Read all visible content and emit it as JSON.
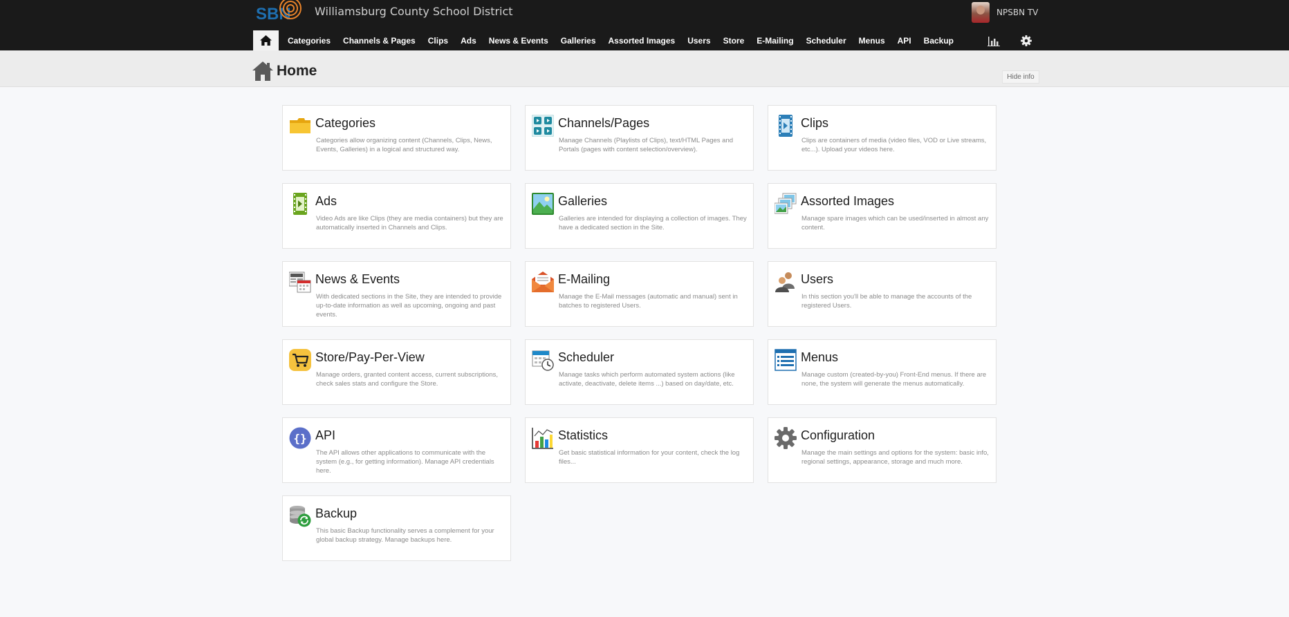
{
  "header": {
    "logo_text": "SBN",
    "site_title": "Williamsburg County School District",
    "user_name": "NPSBN TV"
  },
  "nav": {
    "items": [
      {
        "label": "Categories"
      },
      {
        "label": "Channels & Pages"
      },
      {
        "label": "Clips"
      },
      {
        "label": "Ads"
      },
      {
        "label": "News & Events"
      },
      {
        "label": "Galleries"
      },
      {
        "label": "Assorted Images"
      },
      {
        "label": "Users"
      },
      {
        "label": "Store"
      },
      {
        "label": "E-Mailing"
      },
      {
        "label": "Scheduler"
      },
      {
        "label": "Menus"
      },
      {
        "label": "API"
      },
      {
        "label": "Backup"
      }
    ],
    "icons": [
      "home-icon",
      "statistics-icon",
      "gear-icon"
    ]
  },
  "page": {
    "title": "Home",
    "hide_info_label": "Hide info"
  },
  "cards": [
    {
      "title": "Categories",
      "icon": "folder-icon",
      "desc": "Categories allow organizing content (Channels, Clips, News, Events, Galleries) in a logical and structured way."
    },
    {
      "title": "Channels/Pages",
      "icon": "channels-icon",
      "desc": "Manage Channels (Playlists of Clips), text/HTML Pages and Portals (pages with content selection/overview)."
    },
    {
      "title": "Clips",
      "icon": "film-icon",
      "desc": "Clips are containers of media (video files, VOD or Live streams, etc...). Upload your videos here."
    },
    {
      "title": "Ads",
      "icon": "ad-video-icon",
      "desc": "Video Ads are like Clips (they are media containers) but they are automatically inserted in Channels and Clips."
    },
    {
      "title": "Galleries",
      "icon": "landscape-icon",
      "desc": "Galleries are intended for displaying a collection of images. They have a dedicated section in the Site."
    },
    {
      "title": "Assorted Images",
      "icon": "images-icon",
      "desc": "Manage spare images which can be used/inserted in almost any content."
    },
    {
      "title": "News & Events",
      "icon": "news-icon",
      "desc": "With dedicated sections in the Site, they are intended to provide up-to-date information as well as upcoming, ongoing and past events."
    },
    {
      "title": "E-Mailing",
      "icon": "envelope-icon",
      "desc": "Manage the E-Mail messages (automatic and manual) sent in batches to registered Users."
    },
    {
      "title": "Users",
      "icon": "users-icon",
      "desc": "In this section you'll be able to manage the accounts of the registered Users."
    },
    {
      "title": "Store/Pay-Per-View",
      "icon": "cart-icon",
      "desc": "Manage orders, granted content access, current subscriptions, check sales stats and configure the Store."
    },
    {
      "title": "Scheduler",
      "icon": "calendar-clock-icon",
      "desc": "Manage tasks which perform automated system actions (like activate, deactivate, delete items ...) based on day/date, etc."
    },
    {
      "title": "Menus",
      "icon": "menu-list-icon",
      "desc": "Manage custom (created-by-you) Front-End menus. If there are none, the system will generate the menus automatically."
    },
    {
      "title": "API",
      "icon": "braces-icon",
      "desc": "The API allows other applications to communicate with the system (e.g., for getting information). Manage API credentials here."
    },
    {
      "title": "Statistics",
      "icon": "chart-icon",
      "desc": "Get basic statistical information for your content, check the log files..."
    },
    {
      "title": "Configuration",
      "icon": "cog-icon",
      "desc": "Manage the main settings and options for the system: basic info, regional settings, appearance, storage and much more."
    },
    {
      "title": "Backup",
      "icon": "database-backup-icon",
      "desc": "This basic Backup functionality serves a complement for your global backup strategy. Manage backups here."
    }
  ],
  "colors": {
    "topbar": "#1a1a1a",
    "subheader": "#ececec",
    "background": "#f7f8fa",
    "logo_blue": "#1e6fb0",
    "logo_orange": "#e8832a"
  }
}
